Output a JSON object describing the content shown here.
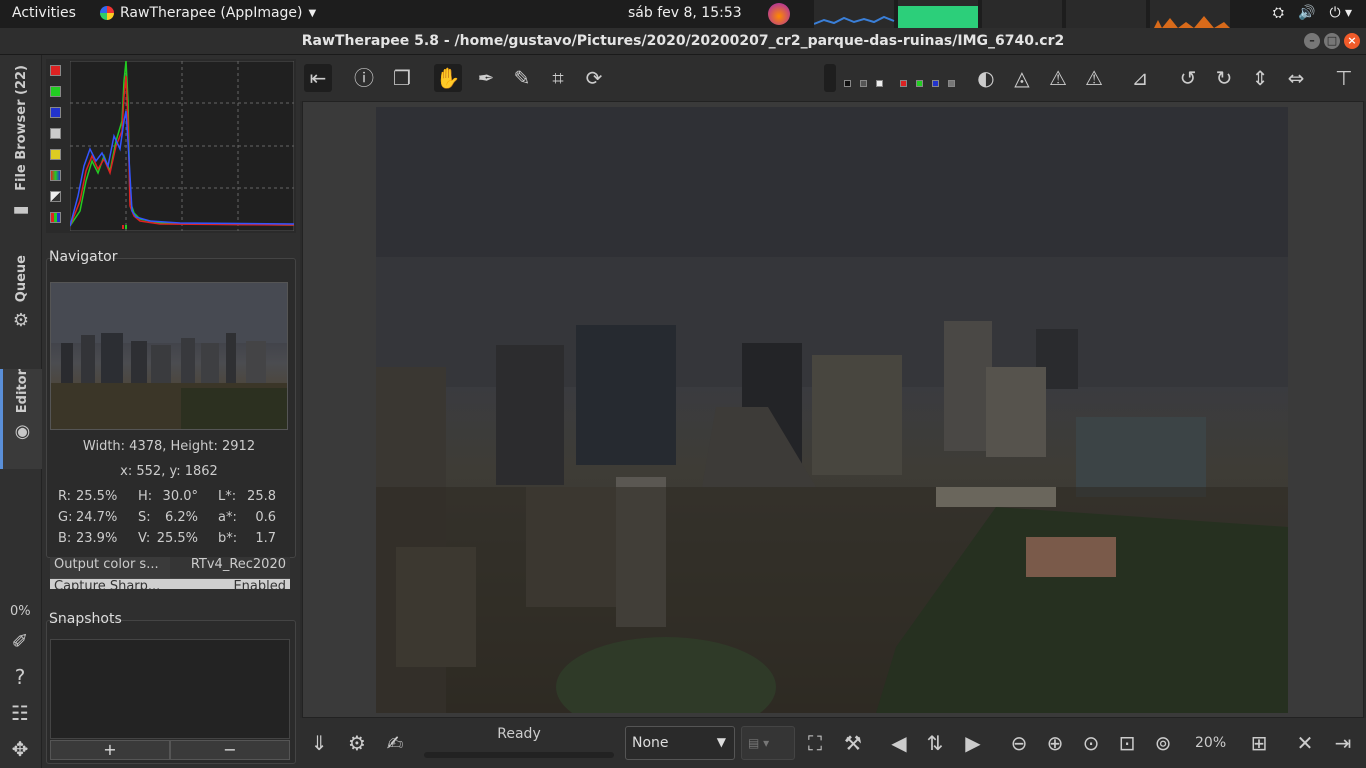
{
  "topbar": {
    "activities": "Activities",
    "app_name": "RawTherapee (AppImage)",
    "clock": "sáb fev  8, 15:53"
  },
  "window": {
    "title": "RawTherapee 5.8 - /home/gustavo/Pictures/2020/20200207_cr2_parque-das-ruinas/IMG_6740.cr2"
  },
  "vtabs": {
    "file_browser": "File Browser (22)",
    "queue": "Queue",
    "editor": "Editor",
    "zoom_pct": "0%"
  },
  "navigator": {
    "title": "Navigator",
    "size": "Width: 4378, Height: 2912",
    "coords": "x: 552, y: 1862",
    "rgb": [
      {
        "k": "R:",
        "v": "25.5%"
      },
      {
        "k": "G:",
        "v": "24.7%"
      },
      {
        "k": "B:",
        "v": "23.9%"
      }
    ],
    "hsv": [
      {
        "k": "H:",
        "v": "30.0°"
      },
      {
        "k": "S:",
        "v": "6.2%"
      },
      {
        "k": "V:",
        "v": "25.5%"
      }
    ],
    "lab": [
      {
        "k": "L*:",
        "v": "25.8"
      },
      {
        "k": "a*:",
        "v": "0.6"
      },
      {
        "k": "b*:",
        "v": "1.7"
      }
    ]
  },
  "info_table": [
    {
      "key": "Output color s...",
      "value": "RTv4_Rec2020"
    },
    {
      "key": "Capture Sharp...",
      "value": "Enabled"
    }
  ],
  "snapshots": {
    "title": "Snapshots",
    "add": "+",
    "remove": "−"
  },
  "bottom": {
    "status": "Ready",
    "select_value": "None",
    "zoom": "20%"
  }
}
